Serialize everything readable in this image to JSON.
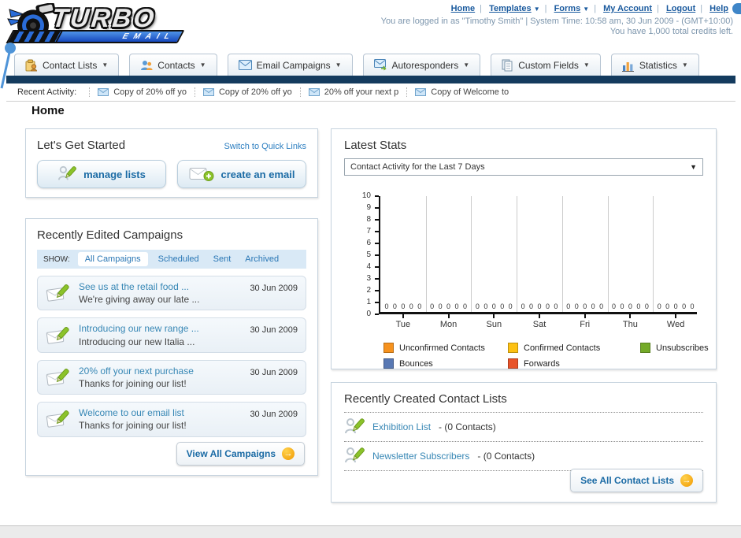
{
  "ui": {
    "caret_down": "▼",
    "pipe": "|",
    "arrow_right": "→"
  },
  "header": {
    "logo_title": "TURBO",
    "logo_subtitle": "EMAIL",
    "nav": {
      "home": "Home",
      "templates": "Templates",
      "forms": "Forms",
      "my_account": "My Account",
      "logout": "Logout",
      "help": "Help"
    },
    "login_line": "You are logged in as \"Timothy Smith\" | System Time: 10:58 am, 30 Jun 2009 - (GMT+10:00)",
    "credits_line": "You have 1,000 total credits left."
  },
  "tabs": [
    {
      "label": "Contact Lists"
    },
    {
      "label": "Contacts"
    },
    {
      "label": "Email Campaigns"
    },
    {
      "label": "Autoresponders"
    },
    {
      "label": "Custom Fields"
    },
    {
      "label": "Statistics"
    }
  ],
  "recent_activity": {
    "label": "Recent Activity:",
    "items": [
      {
        "text": "Copy of 20% off yo"
      },
      {
        "text": "Copy of 20% off yo"
      },
      {
        "text": "20% off your next p"
      },
      {
        "text": "Copy of Welcome to"
      }
    ]
  },
  "page_title": "Home",
  "get_started": {
    "title": "Let's Get Started",
    "switch_link": "Switch to Quick Links",
    "manage_lists_label": "manage lists",
    "create_email_label": "create an email"
  },
  "campaigns_panel": {
    "title": "Recently Edited Campaigns",
    "show_label": "SHOW:",
    "filters": [
      {
        "label": "All Campaigns"
      },
      {
        "label": "Scheduled"
      },
      {
        "label": "Sent"
      },
      {
        "label": "Archived"
      }
    ],
    "items": [
      {
        "title": "See us at the retail food ...",
        "subtitle": "We're giving away our late ...",
        "date": "30 Jun 2009"
      },
      {
        "title": "Introducing our new range ...",
        "subtitle": "Introducing our new Italia ...",
        "date": "30 Jun 2009"
      },
      {
        "title": "20% off your next purchase",
        "subtitle": "Thanks for joining our list!",
        "date": "30 Jun 2009"
      },
      {
        "title": "Welcome to our email list",
        "subtitle": "Thanks for joining our list!",
        "date": "30 Jun 2009"
      }
    ],
    "view_all_label": "View All Campaigns"
  },
  "stats_panel": {
    "title": "Latest Stats",
    "dropdown_value": "Contact Activity for the Last 7 Days"
  },
  "chart_data": {
    "type": "bar",
    "title": "Contact Activity for the Last 7 Days",
    "categories": [
      "Tue",
      "Mon",
      "Sun",
      "Sat",
      "Fri",
      "Thu",
      "Wed"
    ],
    "series": [
      {
        "name": "Unconfirmed Contacts",
        "color": "#f6921e",
        "values": [
          0,
          0,
          0,
          0,
          0,
          0,
          0
        ]
      },
      {
        "name": "Confirmed Contacts",
        "color": "#fdc113",
        "values": [
          0,
          0,
          0,
          0,
          0,
          0,
          0
        ]
      },
      {
        "name": "Unsubscribes",
        "color": "#74aa28",
        "values": [
          0,
          0,
          0,
          0,
          0,
          0,
          0
        ]
      },
      {
        "name": "Bounces",
        "color": "#5878b4",
        "values": [
          0,
          0,
          0,
          0,
          0,
          0,
          0
        ]
      },
      {
        "name": "Forwards",
        "color": "#e8532a",
        "values": [
          0,
          0,
          0,
          0,
          0,
          0,
          0
        ]
      }
    ],
    "ylim": [
      0,
      10
    ],
    "ytick_step": 1,
    "grid": "vertical-group-separators",
    "legend_position": "bottom",
    "value_labels_shown_at_baseline": true
  },
  "contact_lists_panel": {
    "title": "Recently Created Contact Lists",
    "items": [
      {
        "name": "Exhibition List",
        "count_text": "- (0 Contacts)"
      },
      {
        "name": "Newsletter Subscribers",
        "count_text": "- (0 Contacts)"
      }
    ],
    "see_all_label": "See All Contact Lists"
  }
}
